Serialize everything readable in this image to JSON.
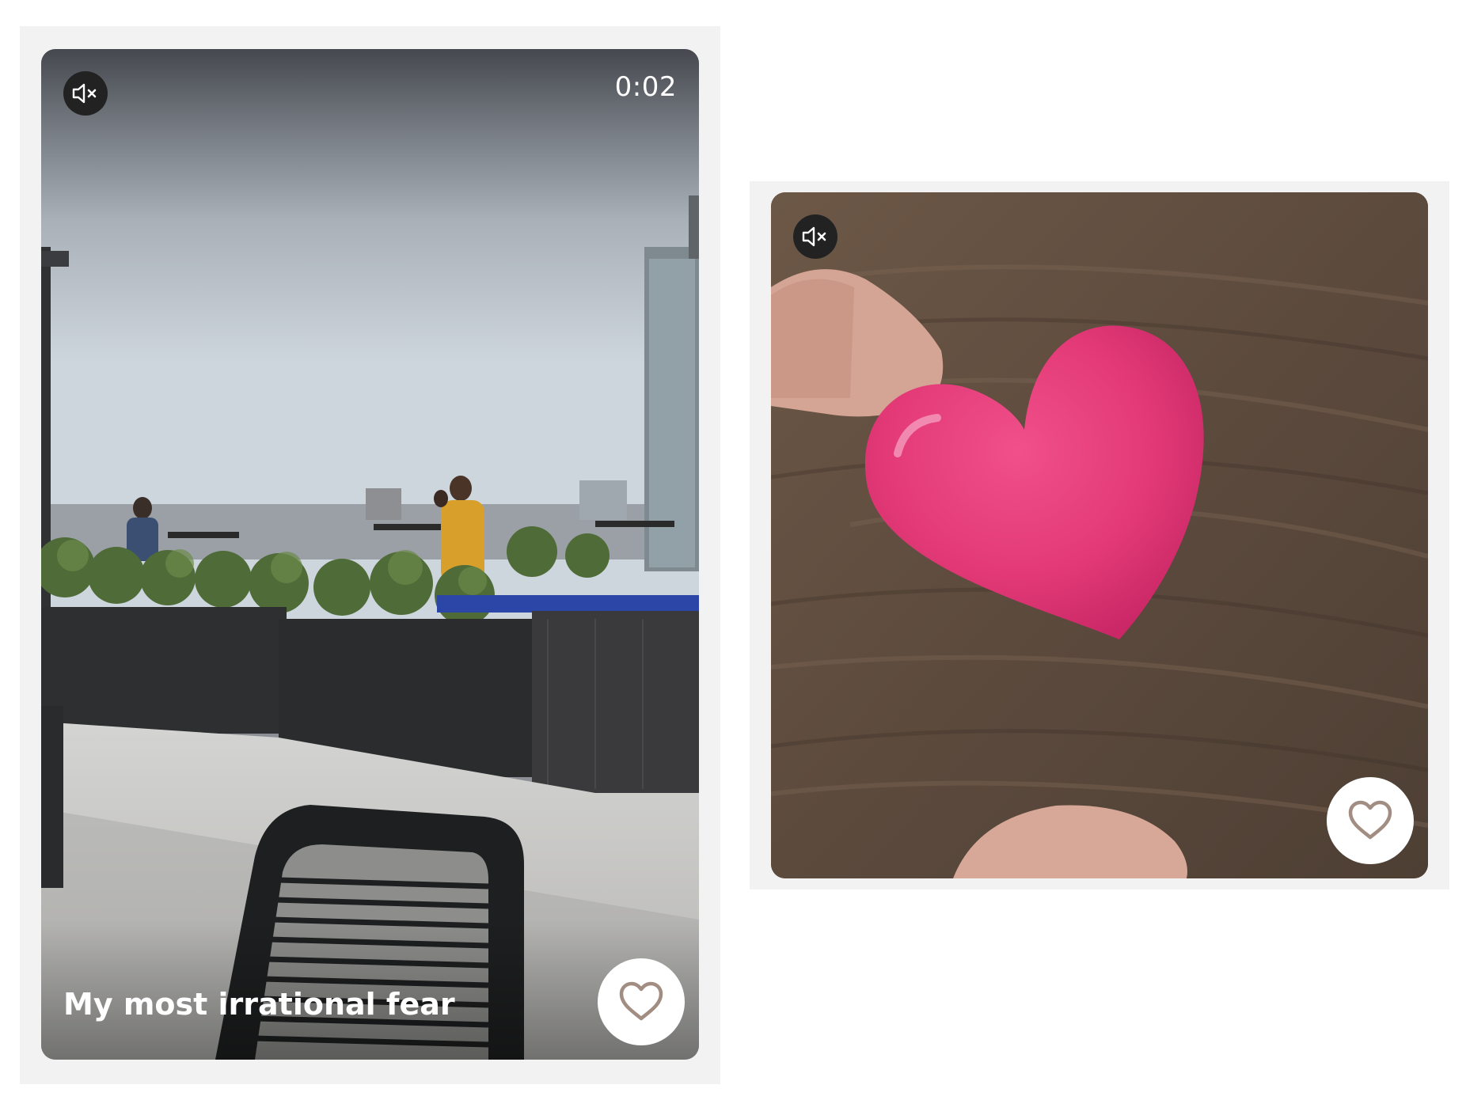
{
  "colors": {
    "frame_bg": "#f2f2f2",
    "like_icon": "#a28d83",
    "overlay_text": "#ffffff"
  },
  "videos": [
    {
      "mute_icon": "speaker-muted-icon",
      "duration": "0:02",
      "caption": "My most irrational fear",
      "like_icon": "heart-outline-icon"
    },
    {
      "mute_icon": "speaker-muted-icon",
      "like_icon": "heart-outline-icon"
    }
  ]
}
